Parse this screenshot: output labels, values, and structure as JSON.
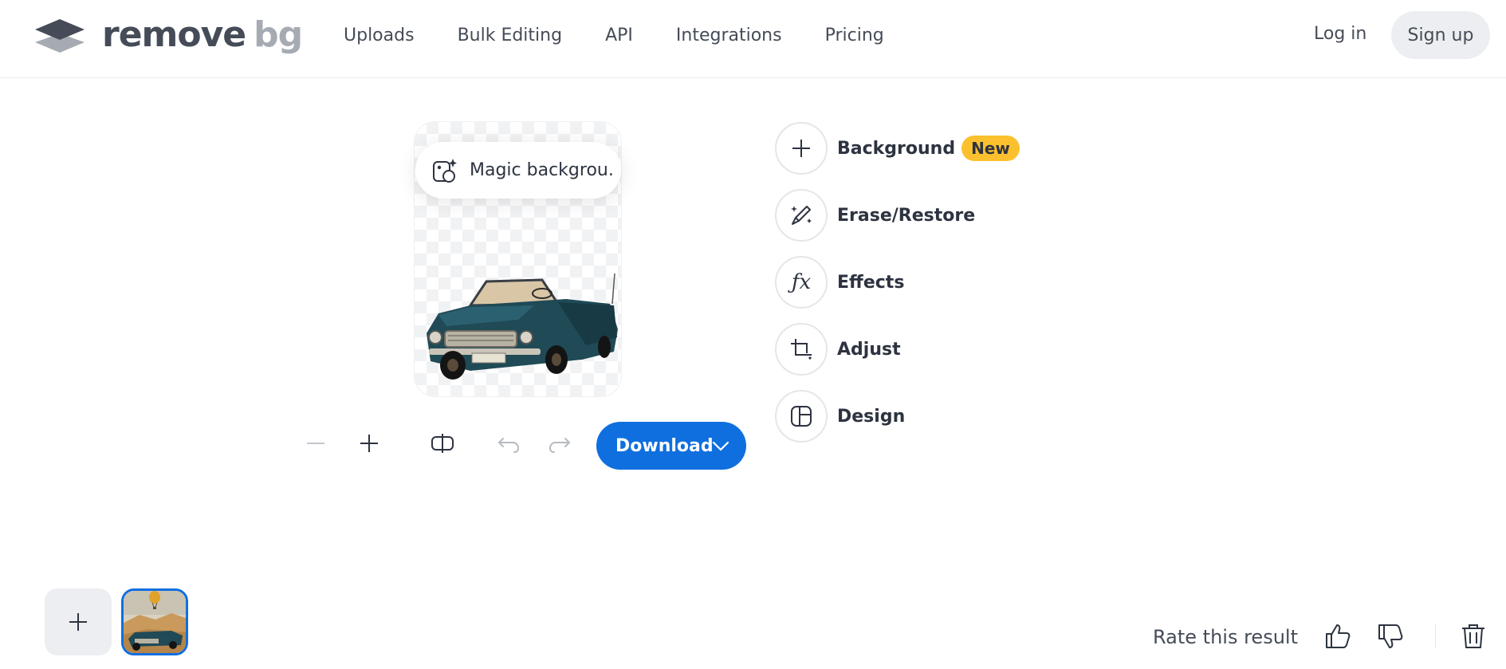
{
  "header": {
    "logo": {
      "word1": "remove",
      "word2": "bg"
    },
    "nav": [
      "Uploads",
      "Bulk Editing",
      "API",
      "Integrations",
      "Pricing"
    ],
    "login_label": "Log in",
    "signup_label": "Sign up"
  },
  "preview": {
    "magic_label": "Magic backgrou..."
  },
  "toolbar": {
    "download_label": "Download"
  },
  "tools": [
    {
      "label": "Background",
      "badge": "New",
      "icon": "plus-icon"
    },
    {
      "label": "Erase/Restore",
      "icon": "brush-sparkle-icon"
    },
    {
      "label": "Effects",
      "icon": "fx-icon"
    },
    {
      "label": "Adjust",
      "icon": "crop-icon"
    },
    {
      "label": "Design",
      "icon": "layout-icon"
    }
  ],
  "footer": {
    "rate_label": "Rate this result"
  },
  "colors": {
    "accent": "#0f6fdf",
    "badge": "#fbc02d",
    "text": "#2d3340"
  }
}
